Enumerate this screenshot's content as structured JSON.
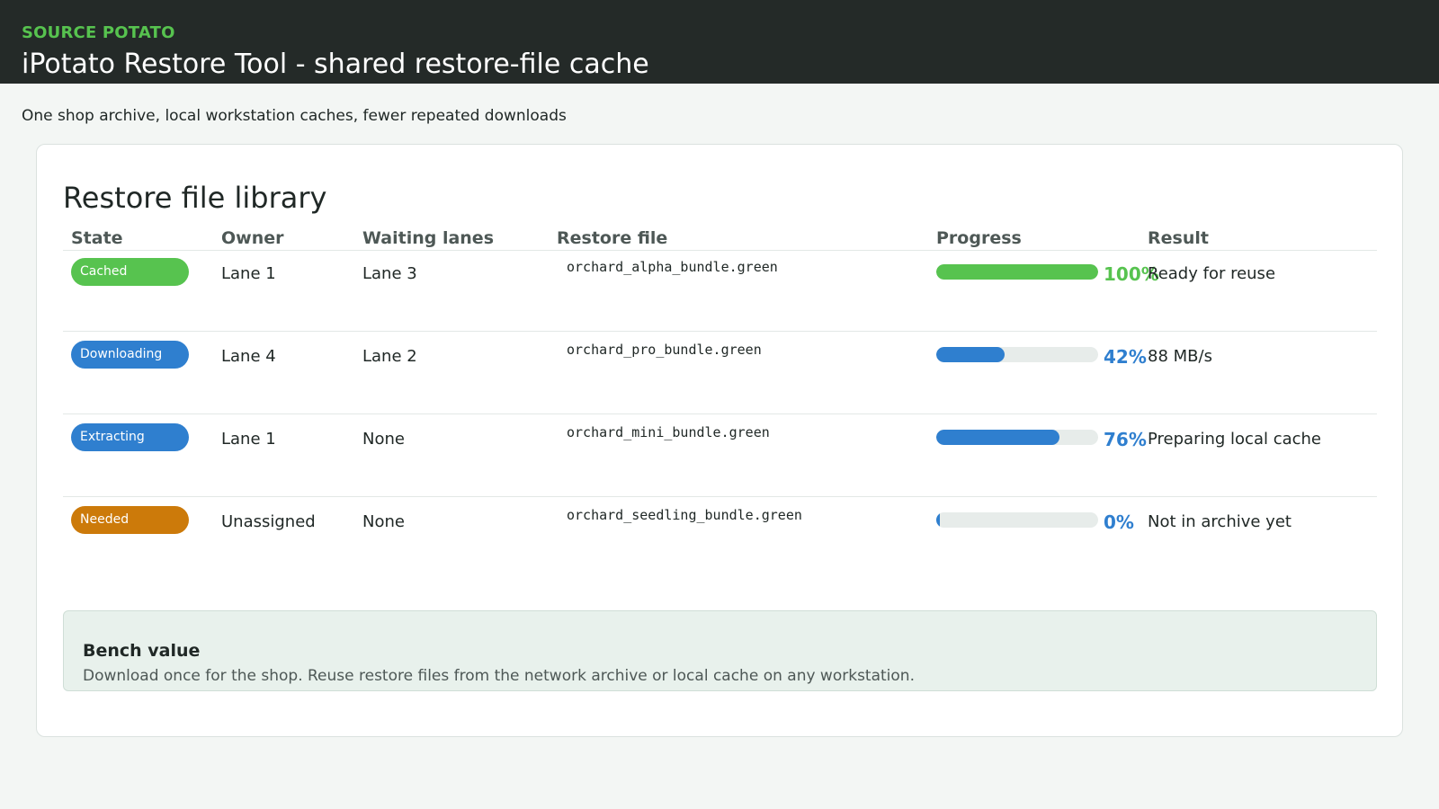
{
  "header": {
    "brand": "SOURCE POTATO",
    "title": "iPotato Restore Tool - shared restore-file cache"
  },
  "subtitle": "One shop archive, local workstation caches, fewer repeated downloads",
  "library": {
    "title": "Restore file library",
    "columns": [
      "State",
      "Owner",
      "Waiting lanes",
      "Restore file",
      "Progress",
      "Result"
    ],
    "rows": [
      {
        "state": "Cached",
        "state_color": "#57c34f",
        "owner": "Lane 1",
        "waiting": "Lane 3",
        "file": "orchard_alpha_bundle.green",
        "progress": 100,
        "progress_label": "100%",
        "progress_color": "#57c34f",
        "result": "Ready for reuse"
      },
      {
        "state": "Downloading",
        "state_color": "#2f7fcf",
        "owner": "Lane 4",
        "waiting": "Lane 2",
        "file": "orchard_pro_bundle.green",
        "progress": 42,
        "progress_label": "42%",
        "progress_color": "#2f7fcf",
        "result": "88 MB/s"
      },
      {
        "state": "Extracting",
        "state_color": "#2f7fcf",
        "owner": "Lane 1",
        "waiting": "None",
        "file": "orchard_mini_bundle.green",
        "progress": 76,
        "progress_label": "76%",
        "progress_color": "#2f7fcf",
        "result": "Preparing local cache"
      },
      {
        "state": "Needed",
        "state_color": "#cc7a0a",
        "owner": "Unassigned",
        "waiting": "None",
        "file": "orchard_seedling_bundle.green",
        "progress": 0,
        "progress_label": "0%",
        "progress_color": "#2f7fcf",
        "result": "Not in archive yet"
      }
    ]
  },
  "bench": {
    "title": "Bench value",
    "text": "Download once for the shop. Reuse restore files from the network archive or local cache on any workstation."
  }
}
